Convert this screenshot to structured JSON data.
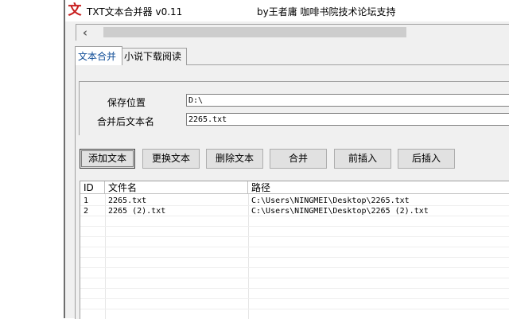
{
  "window": {
    "title": "TXT文本合并器 v0.11",
    "subtitle": "by王者庸 咖啡书院技术论坛支持",
    "icon": "app-icon-glyph",
    "icon_glyph": "文"
  },
  "tabs": [
    {
      "label": "文本合并",
      "active": true
    },
    {
      "label": "小说下载阅读",
      "active": false
    }
  ],
  "form": {
    "save_location_label": "保存位置",
    "save_location_value": "D:\\",
    "output_name_label": "合并后文本名",
    "output_name_value": "2265.txt"
  },
  "buttons": {
    "add": "添加文本",
    "replace": "更换文本",
    "delete": "删除文本",
    "merge": "合并",
    "insert_before": "前插入",
    "insert_after": "后插入"
  },
  "list": {
    "columns": [
      "ID",
      "文件名",
      "路径"
    ],
    "rows": [
      {
        "id": "1",
        "name": "2265.txt",
        "path": "C:\\Users\\NINGMEI\\Desktop\\2265.txt"
      },
      {
        "id": "2",
        "name": "2265 (2).txt",
        "path": "C:\\Users\\NINGMEI\\Desktop\\2265 (2).txt"
      }
    ]
  },
  "colors": {
    "icon_red": "#c81e1e",
    "active_tab_text": "#0f4c96",
    "window_bg": "#f0f0f0"
  }
}
